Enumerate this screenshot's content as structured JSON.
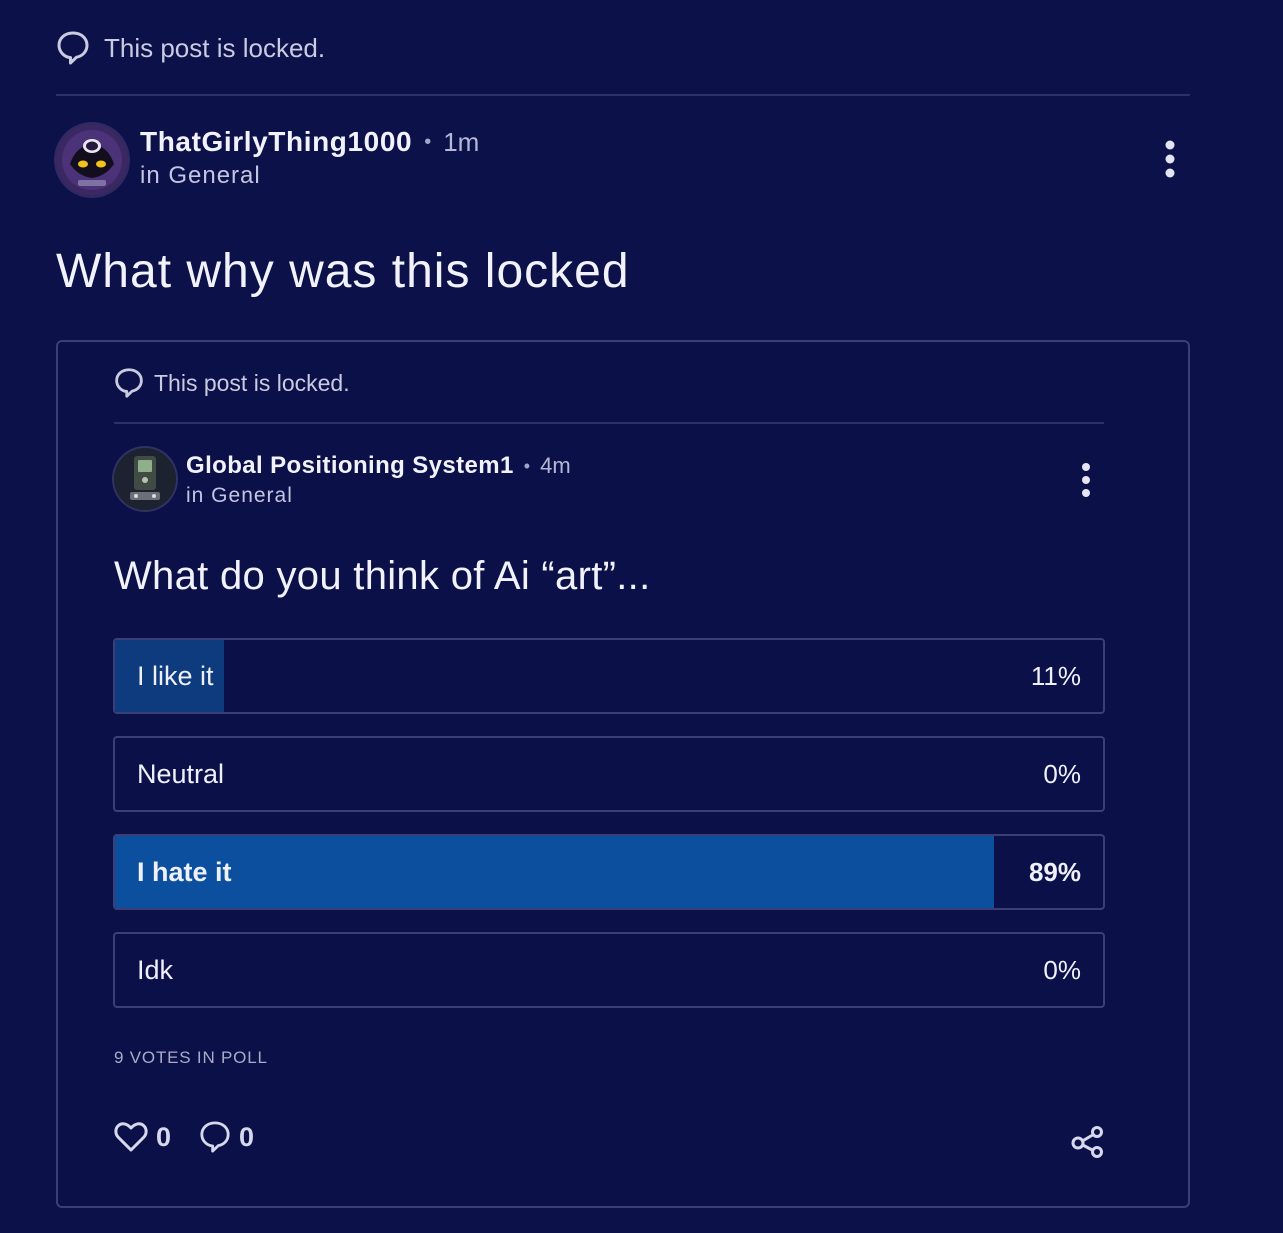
{
  "post": {
    "locked_text": "This post is locked.",
    "author": "ThatGirlyThing1000",
    "time": "1m",
    "community": "in General",
    "title": "What why was this locked"
  },
  "embedded_post": {
    "locked_text": "This post is locked.",
    "author": "Global Positioning System1",
    "time": "4m",
    "community": "in General",
    "title": "What do you think of Ai “art”...",
    "poll": {
      "options": [
        {
          "label": "I like it",
          "percent_text": "11%",
          "fraction": 0.11
        },
        {
          "label": "Neutral",
          "percent_text": "0%",
          "fraction": 0
        },
        {
          "label": "I hate it",
          "percent_text": "89%",
          "fraction": 0.89
        },
        {
          "label": "Idk",
          "percent_text": "0%",
          "fraction": 0
        }
      ],
      "votes_text": "9 VOTES IN POLL"
    },
    "likes": "0",
    "comments": "0"
  },
  "colors": {
    "background": "#0c114a",
    "poll_fill": "#0e3a7e",
    "poll_fill_winner": "#0b4f9e"
  },
  "icons": {
    "locked": "speech-bubble-icon",
    "menu": "vertical-dots-icon",
    "like": "heart-icon",
    "comment": "comment-icon",
    "share": "share-icon"
  }
}
